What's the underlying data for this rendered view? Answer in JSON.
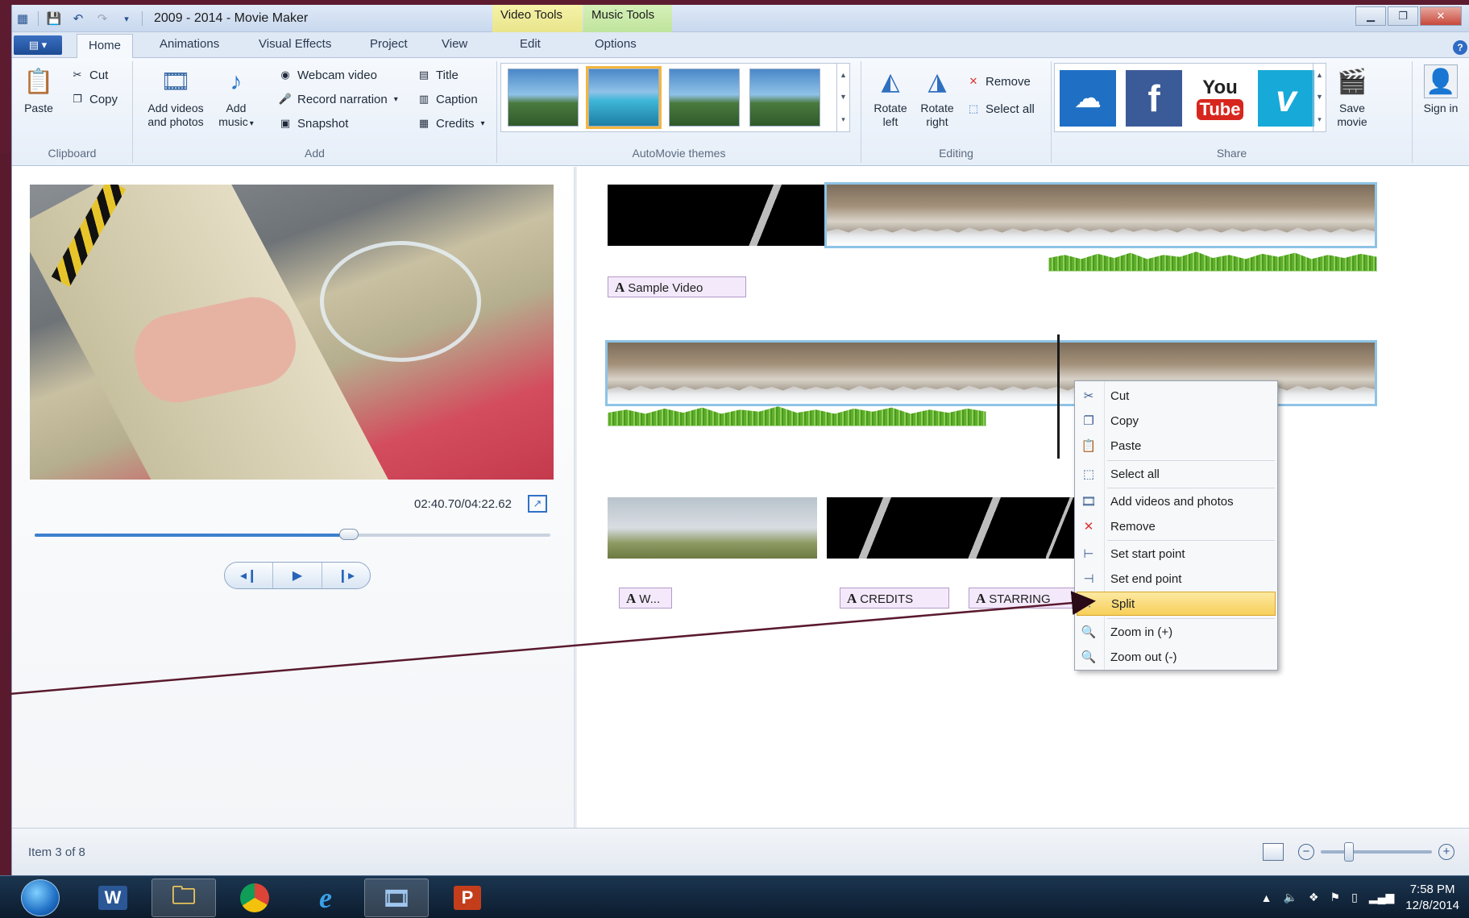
{
  "window": {
    "title": "2009 - 2014 - Movie Maker",
    "context_tabs": {
      "video_tools": "Video Tools",
      "music_tools": "Music Tools"
    }
  },
  "ribbon_tabs": [
    "Home",
    "Animations",
    "Visual Effects",
    "Project",
    "View",
    "Edit",
    "Options"
  ],
  "ribbon": {
    "clipboard": {
      "label": "Clipboard",
      "paste": "Paste",
      "cut": "Cut",
      "copy": "Copy"
    },
    "add": {
      "label": "Add",
      "add_videos": "Add videos and photos",
      "add_music": "Add music",
      "webcam": "Webcam video",
      "narration": "Record narration",
      "snapshot": "Snapshot",
      "title": "Title",
      "caption": "Caption",
      "credits": "Credits"
    },
    "themes": {
      "label": "AutoMovie themes"
    },
    "editing": {
      "label": "Editing",
      "rotate_left": "Rotate left",
      "rotate_right": "Rotate right",
      "remove": "Remove",
      "select_all": "Select all"
    },
    "share": {
      "label": "Share",
      "youtube_you": "You",
      "youtube_tube": "Tube",
      "vimeo": "v",
      "facebook": "f",
      "save_movie": "Save movie",
      "sign_in": "Sign in"
    }
  },
  "preview": {
    "time": "02:40.70/04:22.62",
    "progress": 0.61
  },
  "captions": {
    "sample_video": "Sample Video",
    "w": "W...",
    "credits": "CREDITS",
    "starring": "STARRING"
  },
  "context_menu": {
    "items": [
      {
        "label": "Cut",
        "icon": "scissors-icon"
      },
      {
        "label": "Copy",
        "icon": "copy-icon"
      },
      {
        "label": "Paste",
        "icon": "paste-icon"
      },
      {
        "label": "Select all",
        "icon": "select-all-icon"
      },
      {
        "label": "Add videos and photos",
        "icon": "add-media-icon"
      },
      {
        "label": "Remove",
        "icon": "remove-icon"
      },
      {
        "label": "Set start point",
        "icon": "start-point-icon"
      },
      {
        "label": "Set end point",
        "icon": "end-point-icon"
      },
      {
        "label": "Split",
        "icon": "split-icon"
      },
      {
        "label": "Zoom in (+)",
        "icon": "zoom-in-icon"
      },
      {
        "label": "Zoom out (-)",
        "icon": "zoom-out-icon"
      }
    ],
    "highlighted": "Split"
  },
  "status": {
    "text": "Item 3 of 8",
    "zoom_level": 0.25
  },
  "taskbar": {
    "time": "7:58 PM",
    "date": "12/8/2014",
    "word_label": "W",
    "ppt_label": "P"
  },
  "colors": {
    "accent": "#2f72c7",
    "menu_highlight": "#f7cf5a",
    "desktop": "#5d1b30",
    "audio": "#5fae2a"
  }
}
